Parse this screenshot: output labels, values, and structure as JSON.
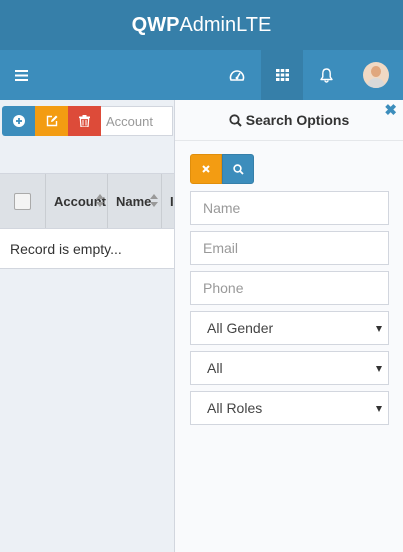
{
  "logo": {
    "bold": "QWP",
    "thin": "AdminLTE"
  },
  "navbar": {
    "icons": [
      "menu-icon",
      "dashboard-icon",
      "apps-grid-icon",
      "bell-icon",
      "avatar"
    ]
  },
  "toolbar": {
    "search_placeholder": "Account"
  },
  "table": {
    "headers": [
      "Account",
      "Name",
      "I"
    ],
    "empty_text": "Record is empty..."
  },
  "search_panel": {
    "title": "Search Options",
    "close_glyph": "✖",
    "name_placeholder": "Name",
    "email_placeholder": "Email",
    "phone_placeholder": "Phone",
    "gender_selected": "All Gender",
    "status_selected": "All",
    "roles_selected": "All Roles"
  },
  "colors": {
    "header": "#367fa9",
    "navbar": "#3c8dbc",
    "warning": "#f39c12",
    "danger": "#dd4b39"
  }
}
